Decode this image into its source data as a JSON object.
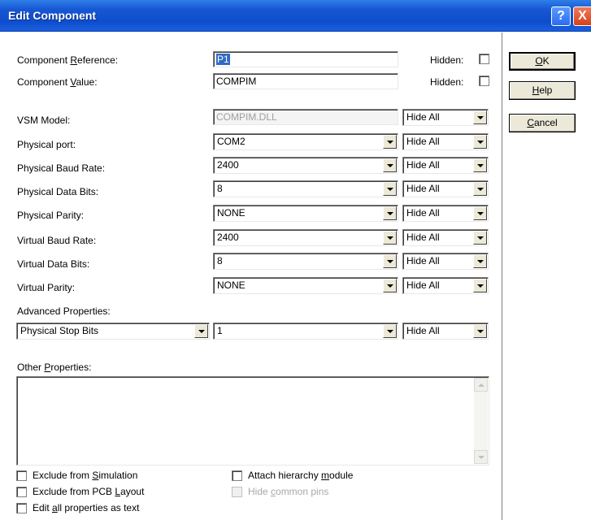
{
  "window": {
    "title": "Edit Component",
    "help_glyph": "?",
    "close_glyph": "X"
  },
  "reference": {
    "label_pre": "Component ",
    "label_key": "R",
    "label_post": "eference:",
    "value": "P1",
    "hidden_label": "Hidden:"
  },
  "value_field": {
    "label_pre": "Component ",
    "label_key": "V",
    "label_post": "alue:",
    "value": "COMPIM",
    "hidden_label": "Hidden:"
  },
  "properties": [
    {
      "label": "VSM Model:",
      "value": "COMPIM.DLL",
      "visibility": "Hide All"
    },
    {
      "label": "Physical port:",
      "value": "COM2",
      "visibility": "Hide All"
    },
    {
      "label": "Physical Baud Rate:",
      "value": "2400",
      "visibility": "Hide All"
    },
    {
      "label": "Physical Data Bits:",
      "value": "8",
      "visibility": "Hide All"
    },
    {
      "label": "Physical Parity:",
      "value": "NONE",
      "visibility": "Hide All"
    },
    {
      "label": "Virtual Baud Rate:",
      "value": "2400",
      "visibility": "Hide All"
    },
    {
      "label": "Virtual Data Bits:",
      "value": "8",
      "visibility": "Hide All"
    },
    {
      "label": "Virtual Parity:",
      "value": "NONE",
      "visibility": "Hide All"
    }
  ],
  "advanced": {
    "label": "Advanced Properties:",
    "property": "Physical Stop Bits",
    "value": "1",
    "visibility": "Hide All"
  },
  "other": {
    "label_pre": "Other ",
    "label_key": "P",
    "label_post": "roperties:",
    "text": ""
  },
  "buttons": {
    "ok_key": "O",
    "ok_rest": "K",
    "help_key": "H",
    "help_rest": "elp",
    "cancel_key": "C",
    "cancel_rest": "ancel"
  },
  "options": {
    "exclude_sim_pre": "Exclude from ",
    "exclude_sim_key": "S",
    "exclude_sim_post": "imulation",
    "exclude_pcb_pre": "Exclude from PCB ",
    "exclude_pcb_key": "L",
    "exclude_pcb_post": "ayout",
    "edit_all_pre": "Edit ",
    "edit_all_key": "a",
    "edit_all_post": "ll properties as text",
    "attach_pre": "Attach hierarchy ",
    "attach_key": "m",
    "attach_post": "odule",
    "hide_pins_pre": "Hide ",
    "hide_pins_key": "c",
    "hide_pins_post": "ommon pins"
  }
}
